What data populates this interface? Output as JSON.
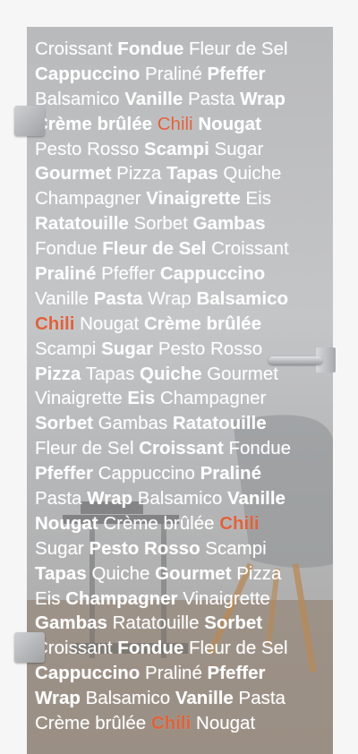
{
  "image": {
    "subject": "glass door with food-word etching",
    "accent_color": "#e0613a",
    "text_color": "#ffffff",
    "glass_color": "#bcbdbf"
  },
  "lines": [
    [
      {
        "t": "Croissant",
        "b": false,
        "h": false
      },
      {
        "t": "Fondue",
        "b": true,
        "h": false
      },
      {
        "t": "Fleur de Sel",
        "b": false,
        "h": false
      }
    ],
    [
      {
        "t": "Cappuccino",
        "b": true,
        "h": false
      },
      {
        "t": "Praliné",
        "b": false,
        "h": false
      },
      {
        "t": "Pfeffer",
        "b": true,
        "h": false
      }
    ],
    [
      {
        "t": "Balsamico",
        "b": false,
        "h": false
      },
      {
        "t": "Vanille",
        "b": true,
        "h": false
      },
      {
        "t": "Pasta",
        "b": false,
        "h": false
      },
      {
        "t": "Wrap",
        "b": true,
        "h": false
      }
    ],
    [
      {
        "t": "Crème brûlée",
        "b": true,
        "h": false
      },
      {
        "t": "Chili",
        "b": false,
        "h": true
      },
      {
        "t": "Nougat",
        "b": true,
        "h": false
      }
    ],
    [
      {
        "t": "Pesto Rosso",
        "b": false,
        "h": false
      },
      {
        "t": "Scampi",
        "b": true,
        "h": false
      },
      {
        "t": "Sugar",
        "b": false,
        "h": false
      }
    ],
    [
      {
        "t": "Gourmet",
        "b": true,
        "h": false
      },
      {
        "t": "Pizza",
        "b": false,
        "h": false
      },
      {
        "t": "Tapas",
        "b": true,
        "h": false
      },
      {
        "t": "Quiche",
        "b": false,
        "h": false
      }
    ],
    [
      {
        "t": "Champagner",
        "b": false,
        "h": false
      },
      {
        "t": "Vinaigrette",
        "b": true,
        "h": false
      },
      {
        "t": "Eis",
        "b": false,
        "h": false
      }
    ],
    [
      {
        "t": "Ratatouille",
        "b": true,
        "h": false
      },
      {
        "t": "Sorbet",
        "b": false,
        "h": false
      },
      {
        "t": "Gambas",
        "b": true,
        "h": false
      }
    ],
    [
      {
        "t": "Fondue",
        "b": false,
        "h": false
      },
      {
        "t": "Fleur de Sel",
        "b": true,
        "h": false
      },
      {
        "t": "Croissant",
        "b": false,
        "h": false
      }
    ],
    [
      {
        "t": "Praliné",
        "b": true,
        "h": false
      },
      {
        "t": "Pfeffer",
        "b": false,
        "h": false
      },
      {
        "t": "Cappuccino",
        "b": true,
        "h": false
      }
    ],
    [
      {
        "t": "Vanille",
        "b": false,
        "h": false
      },
      {
        "t": "Pasta",
        "b": true,
        "h": false
      },
      {
        "t": "Wrap",
        "b": false,
        "h": false
      },
      {
        "t": "Balsamico",
        "b": true,
        "h": false
      }
    ],
    [
      {
        "t": "Chili",
        "b": true,
        "h": true
      },
      {
        "t": "Nougat",
        "b": false,
        "h": false
      },
      {
        "t": "Crème brûlée",
        "b": true,
        "h": false
      }
    ],
    [
      {
        "t": "Scampi",
        "b": false,
        "h": false
      },
      {
        "t": "Sugar",
        "b": true,
        "h": false
      },
      {
        "t": "Pesto Rosso",
        "b": false,
        "h": false
      }
    ],
    [
      {
        "t": "Pizza",
        "b": true,
        "h": false
      },
      {
        "t": "Tapas",
        "b": false,
        "h": false
      },
      {
        "t": "Quiche",
        "b": true,
        "h": false
      },
      {
        "t": "Gourmet",
        "b": false,
        "h": false
      }
    ],
    [
      {
        "t": "Vinaigrette",
        "b": false,
        "h": false
      },
      {
        "t": "Eis",
        "b": true,
        "h": false
      },
      {
        "t": "Champagner",
        "b": false,
        "h": false
      }
    ],
    [
      {
        "t": "Sorbet",
        "b": true,
        "h": false
      },
      {
        "t": "Gambas",
        "b": false,
        "h": false
      },
      {
        "t": "Ratatouille",
        "b": true,
        "h": false
      }
    ],
    [
      {
        "t": "Fleur de Sel",
        "b": false,
        "h": false
      },
      {
        "t": "Croissant",
        "b": true,
        "h": false
      },
      {
        "t": "Fondue",
        "b": false,
        "h": false
      }
    ],
    [
      {
        "t": "Pfeffer",
        "b": true,
        "h": false
      },
      {
        "t": "Cappuccino",
        "b": false,
        "h": false
      },
      {
        "t": "Praliné",
        "b": true,
        "h": false
      }
    ],
    [
      {
        "t": "Pasta",
        "b": false,
        "h": false
      },
      {
        "t": "Wrap",
        "b": true,
        "h": false
      },
      {
        "t": "Balsamico",
        "b": false,
        "h": false
      },
      {
        "t": "Vanille",
        "b": true,
        "h": false
      }
    ],
    [
      {
        "t": "Nougat",
        "b": true,
        "h": false
      },
      {
        "t": "Crème brûlée",
        "b": false,
        "h": false
      },
      {
        "t": "Chili",
        "b": true,
        "h": true
      }
    ],
    [
      {
        "t": "Sugar",
        "b": false,
        "h": false
      },
      {
        "t": "Pesto Rosso",
        "b": true,
        "h": false
      },
      {
        "t": "Scampi",
        "b": false,
        "h": false
      }
    ],
    [
      {
        "t": "Tapas",
        "b": true,
        "h": false
      },
      {
        "t": "Quiche",
        "b": false,
        "h": false
      },
      {
        "t": "Gourmet",
        "b": true,
        "h": false
      },
      {
        "t": "Pizza",
        "b": false,
        "h": false
      }
    ],
    [
      {
        "t": "Eis",
        "b": false,
        "h": false
      },
      {
        "t": "Champagner",
        "b": true,
        "h": false
      },
      {
        "t": "Vinaigrette",
        "b": false,
        "h": false
      }
    ],
    [
      {
        "t": "Gambas",
        "b": true,
        "h": false
      },
      {
        "t": "Ratatouille",
        "b": false,
        "h": false
      },
      {
        "t": "Sorbet",
        "b": true,
        "h": false
      }
    ],
    [
      {
        "t": "Croissant",
        "b": false,
        "h": false
      },
      {
        "t": "Fondue",
        "b": true,
        "h": false
      },
      {
        "t": "Fleur de Sel",
        "b": false,
        "h": false
      }
    ],
    [
      {
        "t": "Cappuccino",
        "b": true,
        "h": false
      },
      {
        "t": "Praliné",
        "b": false,
        "h": false
      },
      {
        "t": "Pfeffer",
        "b": true,
        "h": false
      }
    ],
    [
      {
        "t": "Wrap",
        "b": true,
        "h": false
      },
      {
        "t": "Balsamico",
        "b": false,
        "h": false
      },
      {
        "t": "Vanille",
        "b": true,
        "h": false
      },
      {
        "t": "Pasta",
        "b": false,
        "h": false
      }
    ],
    [
      {
        "t": "Crème brûlée",
        "b": false,
        "h": false
      },
      {
        "t": "Chili",
        "b": true,
        "h": true
      },
      {
        "t": "Nougat",
        "b": false,
        "h": false
      }
    ]
  ]
}
